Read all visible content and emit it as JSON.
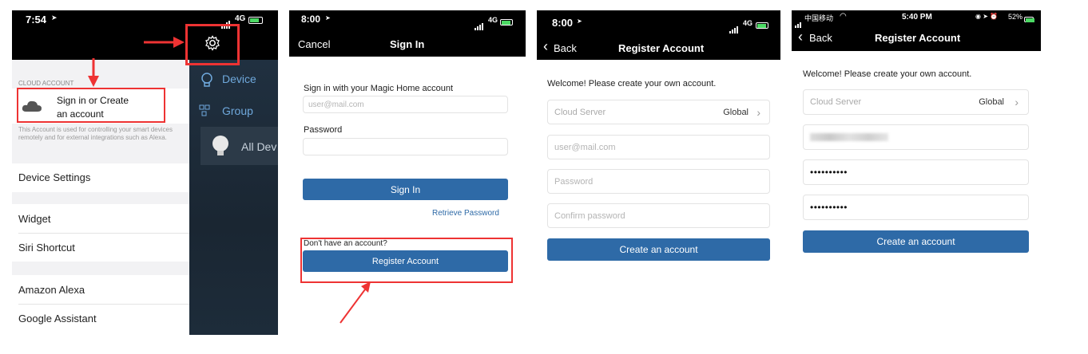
{
  "colors": {
    "accent": "#2e6aa7",
    "highlight": "#e33333",
    "nav_bg": "#000000",
    "drawer_bg": "#1f2a36"
  },
  "panel1": {
    "time": "7:54",
    "network": "4G",
    "section_header": "CLOUD ACCOUNT",
    "signin_line1": "Sign in or Create",
    "signin_line2": "an account",
    "description": "This Account is used for controlling your smart devices remotely and for external integrations such as Alexa.",
    "rows": [
      "Device Settings",
      "Widget",
      "Siri Shortcut",
      "Amazon Alexa",
      "Google Assistant"
    ],
    "drawer": {
      "device": "Device",
      "group": "Group",
      "all_devices": "All Dev"
    },
    "icons": {
      "settings": "gear-icon",
      "cloud": "cloud-icon",
      "bulb": "bulb-icon",
      "group": "group-icon"
    }
  },
  "panel2": {
    "time": "8:00",
    "network": "4G",
    "cancel": "Cancel",
    "title": "Sign In",
    "prompt": "Sign in with your Magic Home account",
    "email_placeholder": "user@mail.com",
    "password_label": "Password",
    "password_placeholder": "",
    "signin_button": "Sign In",
    "retrieve_link": "Retrieve Password",
    "no_account": "Don't have an account?",
    "register_button": "Register Account"
  },
  "panel3": {
    "time": "8:00",
    "network": "4G",
    "back": "Back",
    "title": "Register Account",
    "welcome": "Welcome! Please create your own account.",
    "server_label": "Cloud Server",
    "server_value": "Global",
    "email_placeholder": "user@mail.com",
    "password_placeholder": "Password",
    "confirm_placeholder": "Confirm password",
    "create_button": "Create an account"
  },
  "panel4": {
    "carrier": "中国移动",
    "time": "5:40 PM",
    "battery": "52%",
    "back": "Back",
    "title": "Register Account",
    "welcome": "Welcome! Please create your own account.",
    "server_label": "Cloud Server",
    "server_value": "Global",
    "password_mask": "••••••••••",
    "confirm_mask": "••••••••••",
    "create_button": "Create an account"
  }
}
